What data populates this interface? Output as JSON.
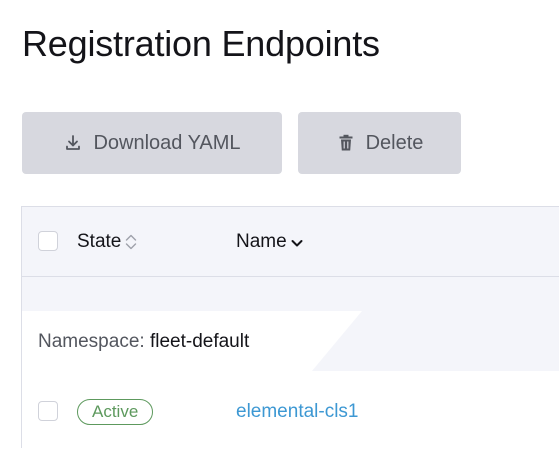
{
  "page": {
    "title": "Registration Endpoints"
  },
  "toolbar": {
    "download_label": "Download YAML",
    "download_icon": "download-icon",
    "delete_label": "Delete",
    "delete_icon": "trash-icon"
  },
  "table": {
    "columns": [
      {
        "label": "State",
        "sort_icon": "sort-both-icon"
      },
      {
        "label": "Name",
        "sort_icon": "sort-down-icon"
      }
    ],
    "group": {
      "key_label": "Namespace:",
      "value": "fleet-default"
    },
    "rows": [
      {
        "state": "Active",
        "name": "elemental-cls1"
      }
    ]
  },
  "colors": {
    "button_bg": "#d7d8df",
    "button_text": "#53565e",
    "header_bg": "#f4f5fa",
    "active_green": "#5d995d",
    "link_blue": "#3d98d3",
    "border": "#dcdee7"
  }
}
